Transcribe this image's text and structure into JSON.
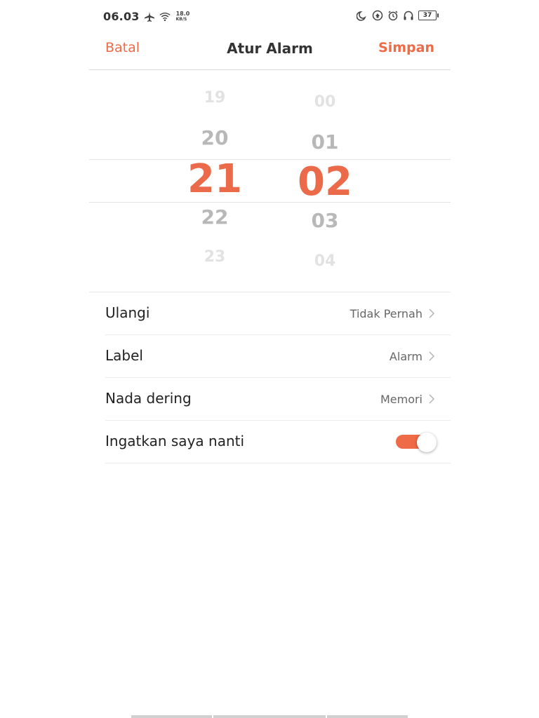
{
  "status_bar": {
    "time": "06.03",
    "net_speed_value": "18.0",
    "net_speed_unit": "KB/S",
    "battery_level": "37",
    "icons": [
      "airplane-icon",
      "wifi-icon",
      "moon-icon",
      "data-saver-icon",
      "alarm-icon",
      "headphones-icon",
      "battery-icon"
    ]
  },
  "header": {
    "cancel_label": "Batal",
    "title": "Atur Alarm",
    "save_label": "Simpan"
  },
  "picker": {
    "hours": {
      "far_above": "19",
      "above": "20",
      "selected": "21",
      "below": "22",
      "far_below": "23"
    },
    "minutes": {
      "far_above": "00",
      "above": "01",
      "selected": "02",
      "below": "03",
      "far_below": "04"
    }
  },
  "settings": {
    "repeat": {
      "label": "Ulangi",
      "value": "Tidak Pernah"
    },
    "label": {
      "label": "Label",
      "value": "Alarm"
    },
    "ringtone": {
      "label": "Nada dering",
      "value": "Memori"
    },
    "snooze": {
      "label": "Ingatkan saya nanti",
      "enabled": true
    }
  },
  "colors": {
    "accent": "#ef6a46",
    "selected_number": "#ea6a49",
    "text_primary": "#222222",
    "text_secondary": "#666666",
    "divider": "#ececec"
  }
}
